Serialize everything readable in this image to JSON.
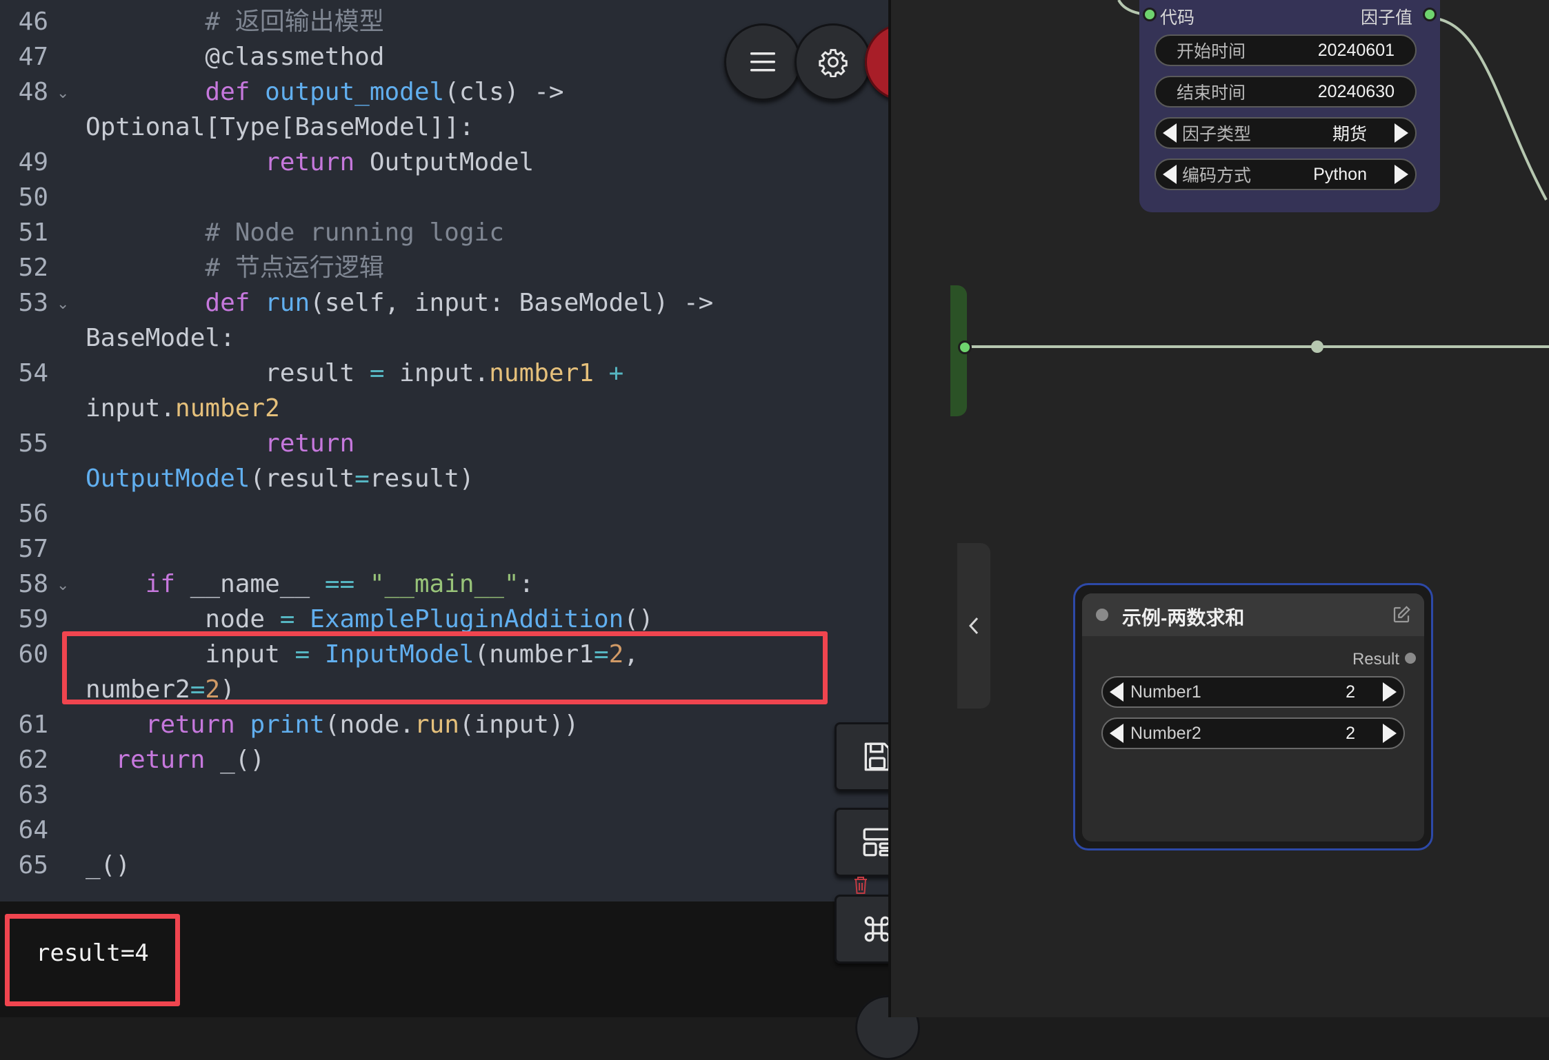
{
  "editor": {
    "lines": [
      {
        "num": "46",
        "fold": "",
        "html": "<span class=\"cm\">        # 返回输出模型</span>"
      },
      {
        "num": "47",
        "fold": "",
        "html": "        <span class=\"dec\">@classmethod</span>"
      },
      {
        "num": "48",
        "fold": "⌄",
        "html": "        <span class=\"kw\">def</span> <span class=\"fn\">output_model</span>(cls) -&gt;"
      },
      {
        "num": "",
        "fold": "",
        "html": "Optional[Type[BaseModel]]:"
      },
      {
        "num": "49",
        "fold": "",
        "html": "            <span class=\"kw\">return</span> OutputModel"
      },
      {
        "num": "50",
        "fold": "",
        "html": ""
      },
      {
        "num": "51",
        "fold": "",
        "html": "<span class=\"cm\">        # Node running logic</span>"
      },
      {
        "num": "52",
        "fold": "",
        "html": "<span class=\"cm\">        # 节点运行逻辑</span>"
      },
      {
        "num": "53",
        "fold": "⌄",
        "html": "        <span class=\"kw\">def</span> <span class=\"fn\">run</span>(self, input: BaseModel) -&gt;"
      },
      {
        "num": "",
        "fold": "",
        "html": "BaseModel:"
      },
      {
        "num": "54",
        "fold": "",
        "html": "            result <span class=\"op\">=</span> input.<span class=\"prop\">number1</span> <span class=\"op\">+</span>"
      },
      {
        "num": "",
        "fold": "",
        "html": "input.<span class=\"prop\">number2</span>"
      },
      {
        "num": "55",
        "fold": "",
        "html": "            <span class=\"kw\">return</span>"
      },
      {
        "num": "",
        "fold": "",
        "html": "<span class=\"fn\">OutputModel</span>(result<span class=\"op\">=</span>result)"
      },
      {
        "num": "56",
        "fold": "",
        "html": ""
      },
      {
        "num": "57",
        "fold": "",
        "html": ""
      },
      {
        "num": "58",
        "fold": "⌄",
        "html": "    <span class=\"kw\">if</span> __name__ <span class=\"op\">==</span> <span class=\"str\">\"__main__\"</span>:"
      },
      {
        "num": "59",
        "fold": "",
        "html": "        node <span class=\"op\">=</span> <span class=\"fn\">ExamplePluginAddition</span>()"
      },
      {
        "num": "60",
        "fold": "",
        "html": "        input <span class=\"op\">=</span> <span class=\"fn\">InputModel</span>(number1<span class=\"op\">=</span><span class=\"num\">2</span>,"
      },
      {
        "num": "",
        "fold": "",
        "html": "number2<span class=\"op\">=</span><span class=\"num\">2</span>)"
      },
      {
        "num": "61",
        "fold": "",
        "html": "    <span class=\"kw\">return</span> <span class=\"fn\">print</span>(node.<span class=\"prop\">run</span>(input))"
      },
      {
        "num": "62",
        "fold": "",
        "html": "  <span class=\"kw\">return</span> _()"
      },
      {
        "num": "63",
        "fold": "",
        "html": ""
      },
      {
        "num": "64",
        "fold": "",
        "html": ""
      },
      {
        "num": "65",
        "fold": "",
        "html": "_()"
      }
    ]
  },
  "toolbar": {
    "menu_icon": "hamburger-menu-icon",
    "settings_icon": "gear-icon",
    "close_icon": "close-x-icon"
  },
  "side_buttons": [
    "save-icon",
    "layout-icon",
    "command-icon"
  ],
  "output": {
    "text": "result=4"
  },
  "factor_node": {
    "header_left": "代码",
    "header_right": "因子值",
    "fields": [
      {
        "label": "开始时间",
        "value": "20240601",
        "arrows": false
      },
      {
        "label": "结束时间",
        "value": "20240630",
        "arrows": false
      },
      {
        "label": "因子类型",
        "value": "期货",
        "arrows": true
      },
      {
        "label": "编码方式",
        "value": "Python",
        "arrows": true
      }
    ]
  },
  "sum_node": {
    "title": "示例-两数求和",
    "output_label": "Result",
    "fields": [
      {
        "label": "Number1",
        "value": "2"
      },
      {
        "label": "Number2",
        "value": "2"
      }
    ]
  },
  "colors": {
    "editor_bg": "#282c34",
    "highlight": "#f0454f",
    "node_purple": "#353356",
    "node_border": "#2d49a8",
    "wire": "#b6c7b0",
    "port_green": "#6fd36f"
  }
}
